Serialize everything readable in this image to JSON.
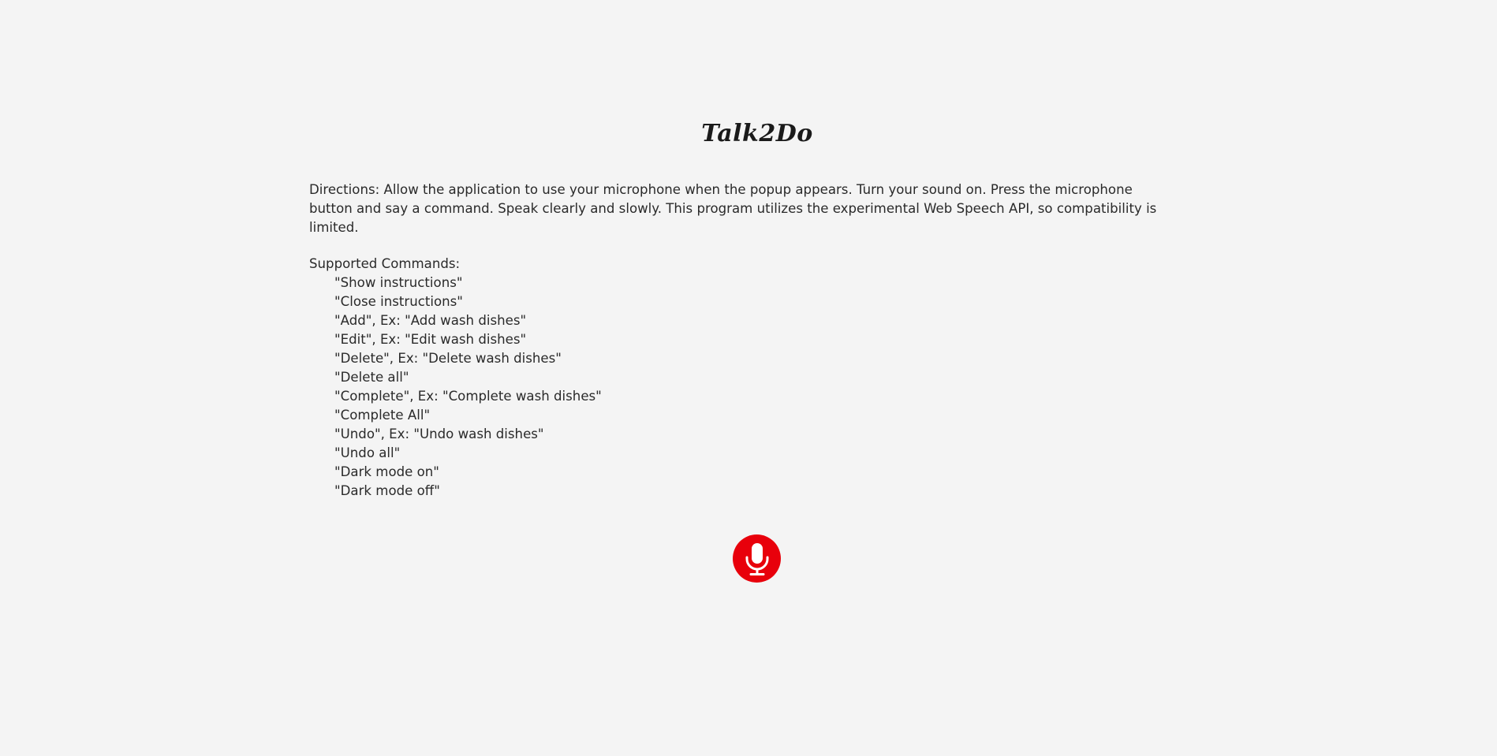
{
  "app": {
    "title": "Talk2Do"
  },
  "instructions": {
    "directions": "Directions: Allow the application to use your microphone when the popup appears. Turn your sound on. Press the microphone button and say a command. Speak clearly and slowly. This program utilizes the experimental Web Speech API, so compatibility is limited.",
    "commands_heading": "Supported Commands:",
    "commands": [
      "\"Show instructions\"",
      "\"Close instructions\"",
      "\"Add\", Ex: \"Add wash dishes\"",
      "\"Edit\", Ex: \"Edit wash dishes\"",
      "\"Delete\", Ex: \"Delete wash dishes\"",
      "\"Delete all\"",
      "\"Complete\", Ex: \"Complete wash dishes\"",
      "\"Complete All\"",
      "\"Undo\", Ex: \"Undo wash dishes\"",
      "\"Undo all\"",
      "\"Dark mode on\"",
      "\"Dark mode off\""
    ]
  },
  "mic": {
    "icon": "microphone-icon",
    "color": "#e8000b"
  }
}
